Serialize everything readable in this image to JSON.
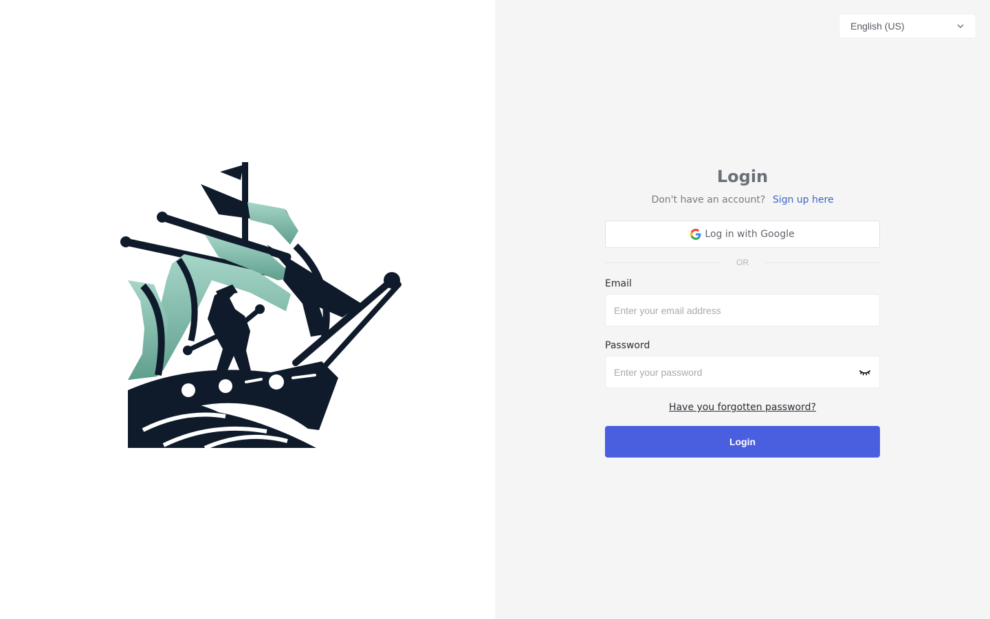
{
  "language_selector": {
    "value": "English (US)",
    "icon": "chevron-down-icon"
  },
  "login": {
    "title": "Login",
    "signup_prompt": "Don't have an account?",
    "signup_link": "Sign up here",
    "google_button": "Log in with Google",
    "divider": "OR",
    "email": {
      "label": "Email",
      "placeholder": "Enter your email address",
      "value": ""
    },
    "password": {
      "label": "Password",
      "placeholder": "Enter your password",
      "value": "",
      "toggle_icon": "eye-closed-icon"
    },
    "forgot_link": "Have you forgotten password?",
    "submit_button": "Login"
  },
  "logo": {
    "icon": "pirate-ship-logo"
  },
  "colors": {
    "primary_button": "#4a5ee0",
    "link": "#3b63c8",
    "logo_dark": "#0f1b2b",
    "logo_teal": "#7bbfae",
    "right_panel_bg": "#f5f5f5"
  }
}
